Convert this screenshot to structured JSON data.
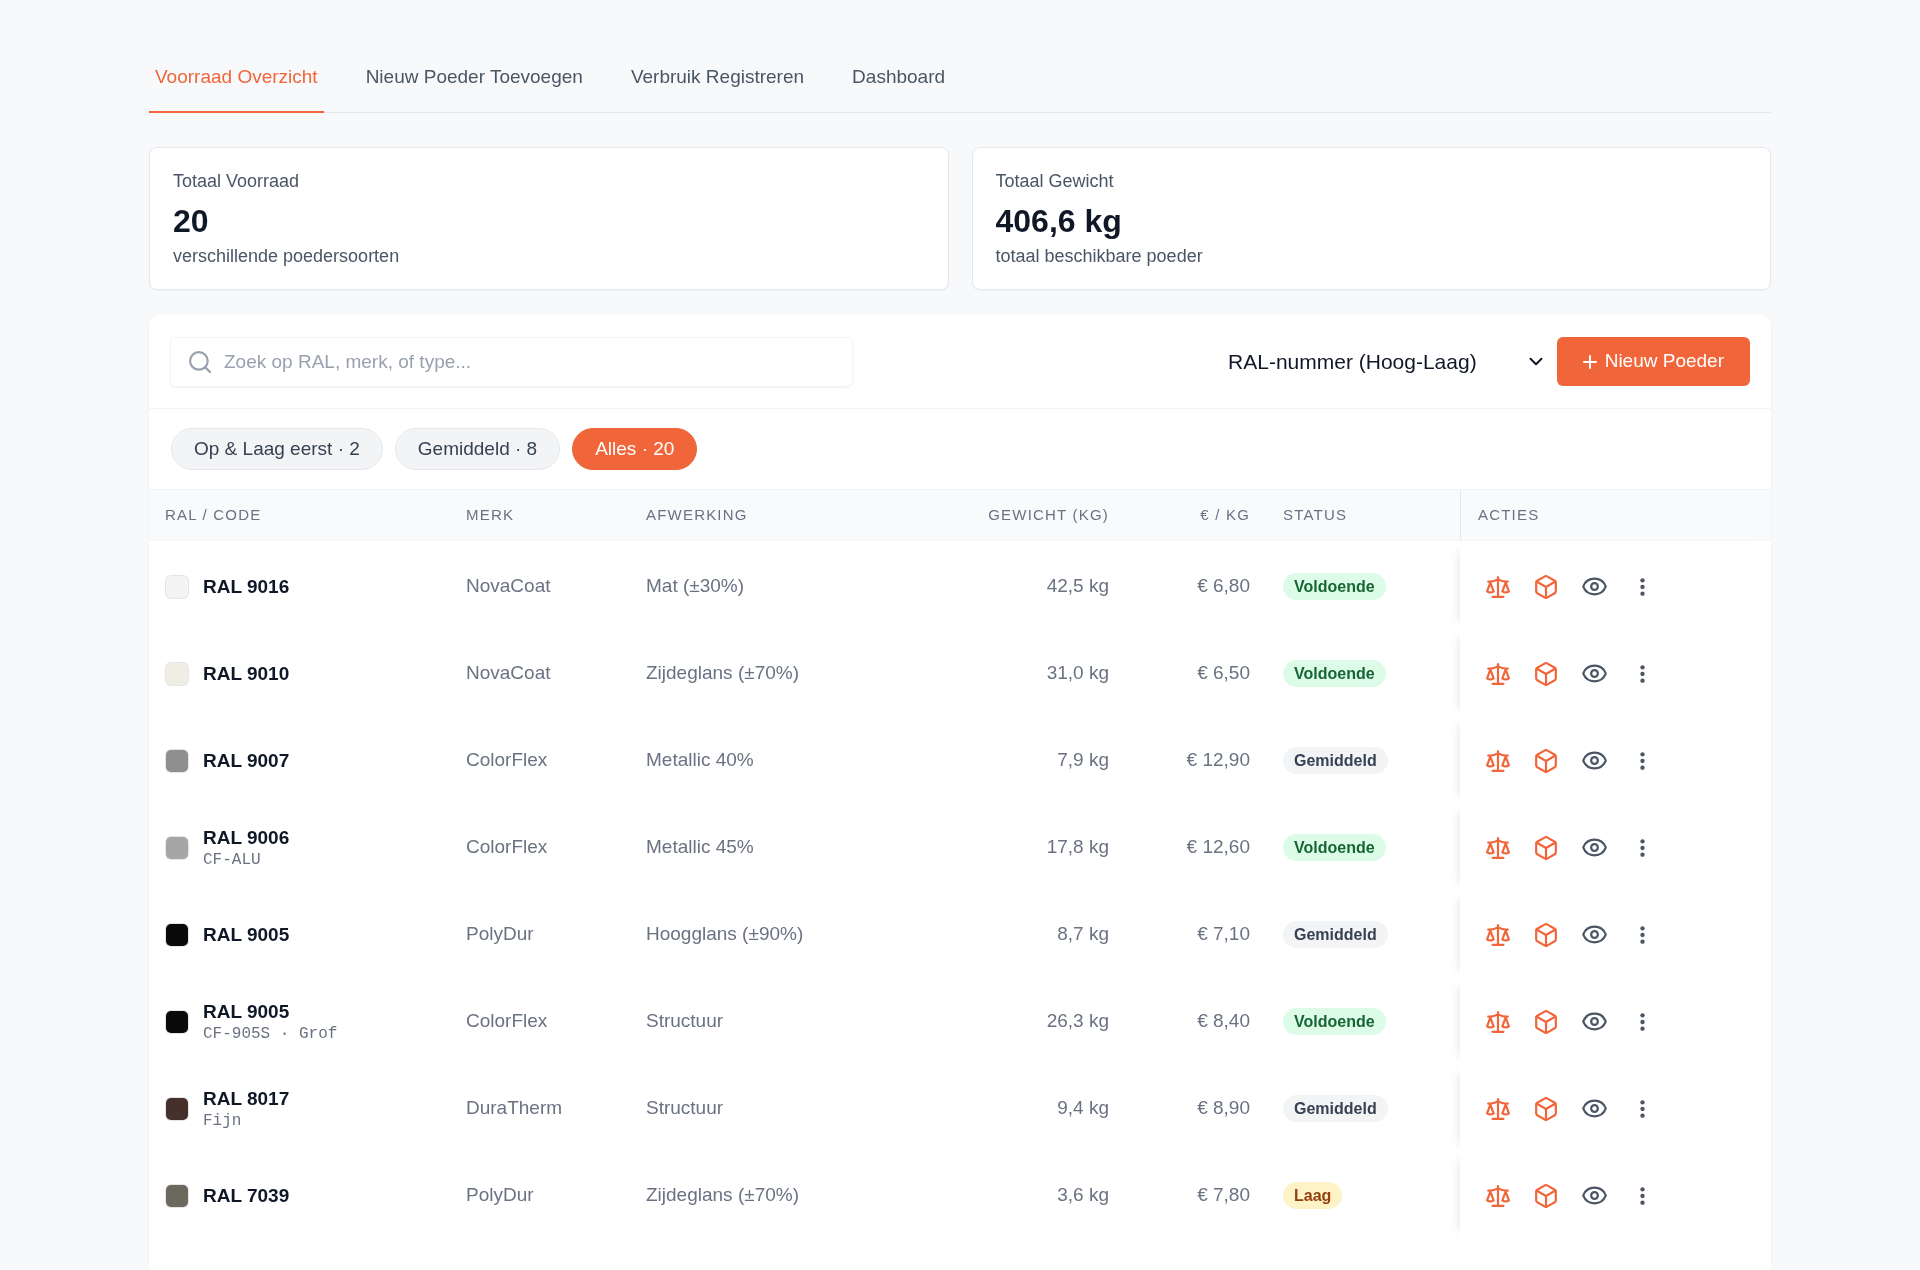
{
  "tabs": [
    {
      "label": "Voorraad Overzicht",
      "selected": true
    },
    {
      "label": "Nieuw Poeder Toevoegen",
      "selected": false
    },
    {
      "label": "Verbruik Registreren",
      "selected": false
    },
    {
      "label": "Dashboard",
      "selected": false
    }
  ],
  "summary_cards": [
    {
      "label": "Totaal Voorraad",
      "value": "20",
      "caption": "verschillende poedersoorten"
    },
    {
      "label": "Totaal Gewicht",
      "value": "406,6 kg",
      "caption": "totaal beschikbare poeder"
    }
  ],
  "toolbar": {
    "search": {
      "placeholder": "Zoek op RAL, merk, of type..."
    },
    "sort": {
      "value": "RAL-nummer (Hoog-Laag)"
    },
    "add_button": {
      "label": "Nieuw Poeder"
    }
  },
  "filters": [
    {
      "label": "Op & Laag eerst · 2",
      "selected": false
    },
    {
      "label": "Gemiddeld · 8",
      "selected": false
    },
    {
      "label": "Alles · 20",
      "selected": true
    }
  ],
  "table": {
    "columns": [
      "RAL / CODE",
      "MERK",
      "AFWERKING",
      "GEWICHT (KG)",
      "€ / KG",
      "STATUS",
      "ACTIES"
    ],
    "rows": [
      {
        "ral": "RAL 9016",
        "color": "#f4f4f5",
        "brand": "NovaCoat",
        "finish": "Mat (±30%)",
        "weight": "42,5 kg",
        "price": "€ 6,80",
        "status": {
          "label": "Voldoende",
          "kind": "ok"
        }
      },
      {
        "ral": "RAL 9010",
        "color": "#f0ede4",
        "brand": "NovaCoat",
        "finish": "Zijdeglans (±70%)",
        "weight": "31,0 kg",
        "price": "€ 6,50",
        "status": {
          "label": "Voldoende",
          "kind": "ok"
        }
      },
      {
        "ral": "RAL 9007",
        "color": "#8f8f8f",
        "brand": "ColorFlex",
        "finish": "Metallic 40%",
        "weight": "7,9 kg",
        "price": "€ 12,90",
        "status": {
          "label": "Gemiddeld",
          "kind": "medium"
        }
      },
      {
        "ral": "RAL 9006",
        "code": "CF-ALU",
        "color": "#a6a6a6",
        "brand": "ColorFlex",
        "finish": "Metallic 45%",
        "weight": "17,8 kg",
        "price": "€ 12,60",
        "status": {
          "label": "Voldoende",
          "kind": "ok"
        }
      },
      {
        "ral": "RAL 9005",
        "color": "#0a0a0a",
        "brand": "PolyDur",
        "finish": "Hoogglans (±90%)",
        "weight": "8,7 kg",
        "price": "€ 7,10",
        "status": {
          "label": "Gemiddeld",
          "kind": "medium"
        }
      },
      {
        "ral": "RAL 9005",
        "code": "CF-905S · Grof",
        "color": "#0a0a0a",
        "brand": "ColorFlex",
        "finish": "Structuur",
        "weight": "26,3 kg",
        "price": "€ 8,40",
        "status": {
          "label": "Voldoende",
          "kind": "ok"
        }
      },
      {
        "ral": "RAL 8017",
        "code": "Fijn",
        "color": "#45302b",
        "brand": "DuraTherm",
        "finish": "Structuur",
        "weight": "9,4 kg",
        "price": "€ 8,90",
        "status": {
          "label": "Gemiddeld",
          "kind": "medium"
        }
      },
      {
        "ral": "RAL 7039",
        "color": "#6b695e",
        "brand": "PolyDur",
        "finish": "Zijdeglans (±70%)",
        "weight": "3,6 kg",
        "price": "€ 7,80",
        "status": {
          "label": "Laag",
          "kind": "low"
        }
      }
    ]
  }
}
